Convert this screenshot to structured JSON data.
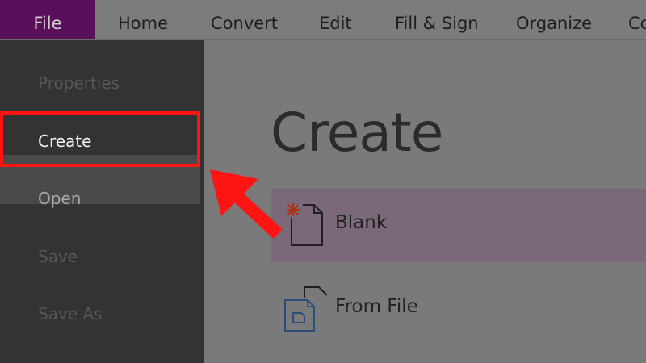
{
  "menubar": {
    "tabs": [
      "File",
      "Home",
      "Convert",
      "Edit",
      "Fill & Sign",
      "Organize",
      "Co"
    ]
  },
  "sidebar": {
    "items": [
      {
        "label": "Properties",
        "state": "disabled"
      },
      {
        "label": "Create",
        "state": "active"
      },
      {
        "label": "Open",
        "state": "normal"
      },
      {
        "label": "Save",
        "state": "disabled"
      },
      {
        "label": "Save As",
        "state": "disabled"
      }
    ]
  },
  "main": {
    "title": "Create",
    "options": [
      {
        "label": "Blank",
        "icon": "blank-document-icon",
        "selected": true
      },
      {
        "label": "From File",
        "icon": "document-from-file-icon",
        "selected": false
      }
    ]
  },
  "annotation": {
    "color": "#ff1414",
    "highlighted_item": "Create",
    "arrow": "points-to-highlighted-item"
  },
  "colors": {
    "file_tab": "#5a0f5a",
    "sidebar": "#333333",
    "selected_option": "#7b6879"
  }
}
